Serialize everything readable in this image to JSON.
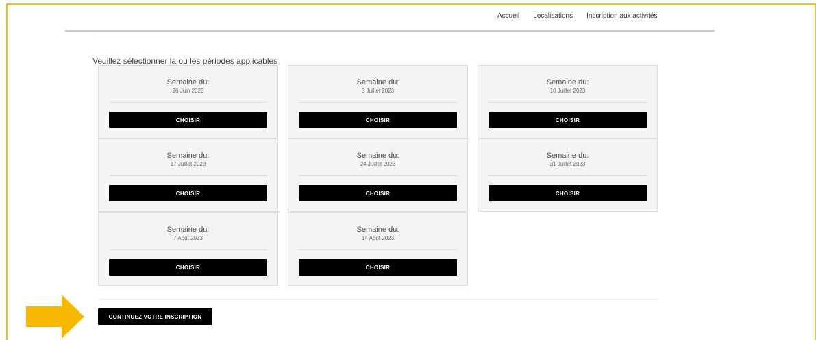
{
  "nav": {
    "items": [
      {
        "label": "Accueil"
      },
      {
        "label": "Localisations"
      },
      {
        "label": "Inscription aux activités"
      }
    ]
  },
  "section": {
    "heading": "Veuillez sélectionner la ou les périodes applicables"
  },
  "weeks": [
    {
      "title": "Semaine du:",
      "date": "26 Juin 2023",
      "button": "CHOISIR"
    },
    {
      "title": "Semaine du:",
      "date": "3 Juillet 2023",
      "button": "CHOISIR"
    },
    {
      "title": "Semaine du:",
      "date": "10 Juillet 2023",
      "button": "CHOISIR"
    },
    {
      "title": "Semaine du:",
      "date": "17 Juillet 2023",
      "button": "CHOISIR"
    },
    {
      "title": "Semaine du:",
      "date": "24 Juillet 2023",
      "button": "CHOISIR"
    },
    {
      "title": "Semaine du:",
      "date": "31 Juillet 2023",
      "button": "CHOISIR"
    },
    {
      "title": "Semaine du:",
      "date": "7 Août 2023",
      "button": "CHOISIR"
    },
    {
      "title": "Semaine du:",
      "date": "14 Août 2023",
      "button": "CHOISIR"
    }
  ],
  "actions": {
    "continue_label": "CONTINUEZ VOTRE INSCRIPTION"
  },
  "colors": {
    "frame": "#f5c400",
    "arrow": "#f7b800",
    "button_bg": "#000000",
    "card_bg": "#f4f4f4"
  },
  "icons": {
    "annotation": "arrow-right-icon"
  }
}
